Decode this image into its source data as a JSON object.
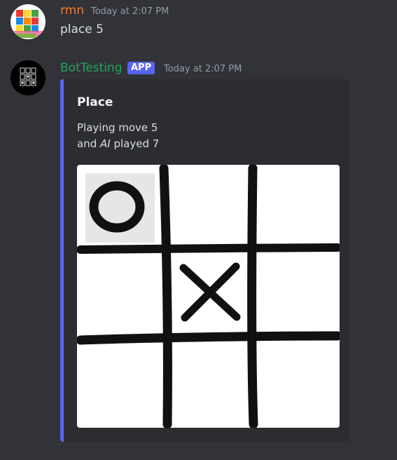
{
  "messages": [
    {
      "author": "rmn",
      "author_color": "#f47b35",
      "timestamp": "Today at 2:07 PM",
      "text": "place 5"
    },
    {
      "author": "BotTesting",
      "author_color": "#23a559",
      "badge": "APP",
      "timestamp": "Today at 2:07 PM",
      "embed": {
        "accent_color": "#5865f2",
        "title": "Place",
        "line1": "Playing move 5",
        "line2_prefix": "and ",
        "line2_em": "AI",
        "line2_suffix": " played 7",
        "board": {
          "cells": [
            "O",
            "",
            "",
            "",
            "X",
            "",
            "",
            "",
            ""
          ],
          "highlighted_cell": 1
        }
      }
    }
  ]
}
